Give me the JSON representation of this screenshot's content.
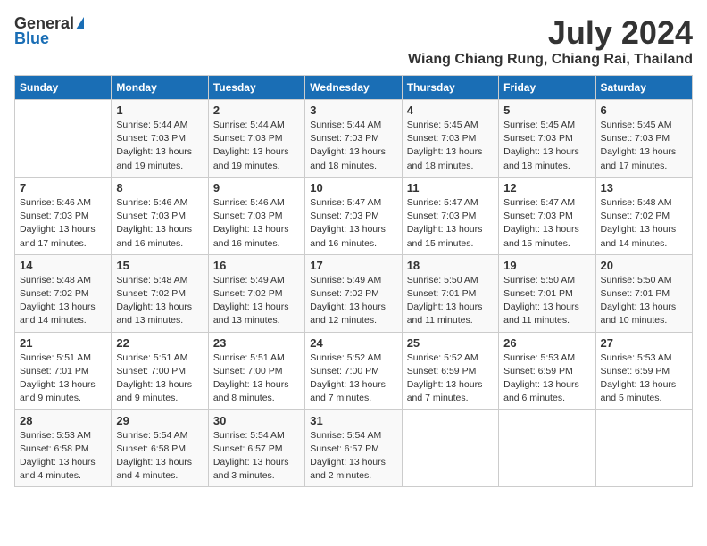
{
  "header": {
    "logo_general": "General",
    "logo_blue": "Blue",
    "month_year": "July 2024",
    "location": "Wiang Chiang Rung, Chiang Rai, Thailand"
  },
  "days_of_week": [
    "Sunday",
    "Monday",
    "Tuesday",
    "Wednesday",
    "Thursday",
    "Friday",
    "Saturday"
  ],
  "weeks": [
    [
      {
        "day": "",
        "content": ""
      },
      {
        "day": "1",
        "content": "Sunrise: 5:44 AM\nSunset: 7:03 PM\nDaylight: 13 hours\nand 19 minutes."
      },
      {
        "day": "2",
        "content": "Sunrise: 5:44 AM\nSunset: 7:03 PM\nDaylight: 13 hours\nand 19 minutes."
      },
      {
        "day": "3",
        "content": "Sunrise: 5:44 AM\nSunset: 7:03 PM\nDaylight: 13 hours\nand 18 minutes."
      },
      {
        "day": "4",
        "content": "Sunrise: 5:45 AM\nSunset: 7:03 PM\nDaylight: 13 hours\nand 18 minutes."
      },
      {
        "day": "5",
        "content": "Sunrise: 5:45 AM\nSunset: 7:03 PM\nDaylight: 13 hours\nand 18 minutes."
      },
      {
        "day": "6",
        "content": "Sunrise: 5:45 AM\nSunset: 7:03 PM\nDaylight: 13 hours\nand 17 minutes."
      }
    ],
    [
      {
        "day": "7",
        "content": "Sunrise: 5:46 AM\nSunset: 7:03 PM\nDaylight: 13 hours\nand 17 minutes."
      },
      {
        "day": "8",
        "content": "Sunrise: 5:46 AM\nSunset: 7:03 PM\nDaylight: 13 hours\nand 16 minutes."
      },
      {
        "day": "9",
        "content": "Sunrise: 5:46 AM\nSunset: 7:03 PM\nDaylight: 13 hours\nand 16 minutes."
      },
      {
        "day": "10",
        "content": "Sunrise: 5:47 AM\nSunset: 7:03 PM\nDaylight: 13 hours\nand 16 minutes."
      },
      {
        "day": "11",
        "content": "Sunrise: 5:47 AM\nSunset: 7:03 PM\nDaylight: 13 hours\nand 15 minutes."
      },
      {
        "day": "12",
        "content": "Sunrise: 5:47 AM\nSunset: 7:03 PM\nDaylight: 13 hours\nand 15 minutes."
      },
      {
        "day": "13",
        "content": "Sunrise: 5:48 AM\nSunset: 7:02 PM\nDaylight: 13 hours\nand 14 minutes."
      }
    ],
    [
      {
        "day": "14",
        "content": "Sunrise: 5:48 AM\nSunset: 7:02 PM\nDaylight: 13 hours\nand 14 minutes."
      },
      {
        "day": "15",
        "content": "Sunrise: 5:48 AM\nSunset: 7:02 PM\nDaylight: 13 hours\nand 13 minutes."
      },
      {
        "day": "16",
        "content": "Sunrise: 5:49 AM\nSunset: 7:02 PM\nDaylight: 13 hours\nand 13 minutes."
      },
      {
        "day": "17",
        "content": "Sunrise: 5:49 AM\nSunset: 7:02 PM\nDaylight: 13 hours\nand 12 minutes."
      },
      {
        "day": "18",
        "content": "Sunrise: 5:50 AM\nSunset: 7:01 PM\nDaylight: 13 hours\nand 11 minutes."
      },
      {
        "day": "19",
        "content": "Sunrise: 5:50 AM\nSunset: 7:01 PM\nDaylight: 13 hours\nand 11 minutes."
      },
      {
        "day": "20",
        "content": "Sunrise: 5:50 AM\nSunset: 7:01 PM\nDaylight: 13 hours\nand 10 minutes."
      }
    ],
    [
      {
        "day": "21",
        "content": "Sunrise: 5:51 AM\nSunset: 7:01 PM\nDaylight: 13 hours\nand 9 minutes."
      },
      {
        "day": "22",
        "content": "Sunrise: 5:51 AM\nSunset: 7:00 PM\nDaylight: 13 hours\nand 9 minutes."
      },
      {
        "day": "23",
        "content": "Sunrise: 5:51 AM\nSunset: 7:00 PM\nDaylight: 13 hours\nand 8 minutes."
      },
      {
        "day": "24",
        "content": "Sunrise: 5:52 AM\nSunset: 7:00 PM\nDaylight: 13 hours\nand 7 minutes."
      },
      {
        "day": "25",
        "content": "Sunrise: 5:52 AM\nSunset: 6:59 PM\nDaylight: 13 hours\nand 7 minutes."
      },
      {
        "day": "26",
        "content": "Sunrise: 5:53 AM\nSunset: 6:59 PM\nDaylight: 13 hours\nand 6 minutes."
      },
      {
        "day": "27",
        "content": "Sunrise: 5:53 AM\nSunset: 6:59 PM\nDaylight: 13 hours\nand 5 minutes."
      }
    ],
    [
      {
        "day": "28",
        "content": "Sunrise: 5:53 AM\nSunset: 6:58 PM\nDaylight: 13 hours\nand 4 minutes."
      },
      {
        "day": "29",
        "content": "Sunrise: 5:54 AM\nSunset: 6:58 PM\nDaylight: 13 hours\nand 4 minutes."
      },
      {
        "day": "30",
        "content": "Sunrise: 5:54 AM\nSunset: 6:57 PM\nDaylight: 13 hours\nand 3 minutes."
      },
      {
        "day": "31",
        "content": "Sunrise: 5:54 AM\nSunset: 6:57 PM\nDaylight: 13 hours\nand 2 minutes."
      },
      {
        "day": "",
        "content": ""
      },
      {
        "day": "",
        "content": ""
      },
      {
        "day": "",
        "content": ""
      }
    ]
  ]
}
